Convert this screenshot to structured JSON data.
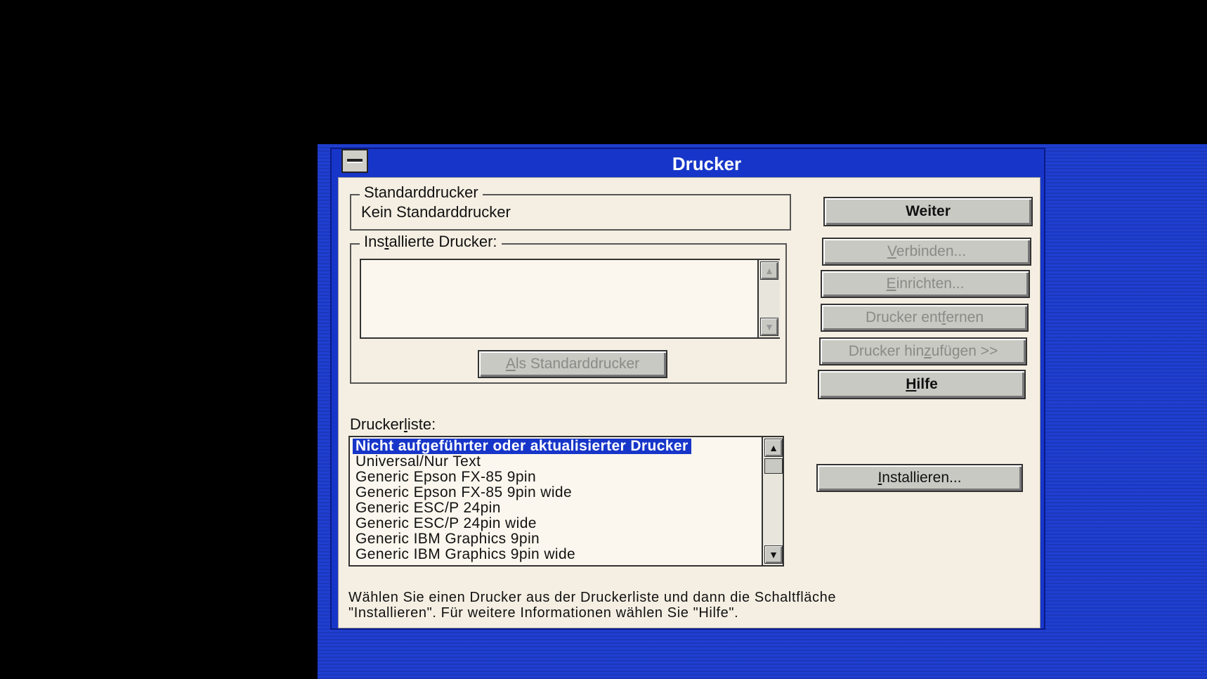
{
  "window": {
    "title": "Drucker"
  },
  "default_printer": {
    "label": "Standarddrucker",
    "value": "Kein Standarddrucker"
  },
  "installed": {
    "label_pre": "Ins",
    "label_ul": "t",
    "label_post": "allierte Drucker:",
    "set_default_ul": "A",
    "set_default_rest": "ls Standarddrucker"
  },
  "buttons": {
    "weiter": "Weiter",
    "verbinden_ul": "V",
    "verbinden_rest": "erbinden...",
    "einrichten_ul": "E",
    "einrichten_rest": "inrichten...",
    "entfernen_pre": "Drucker ent",
    "entfernen_ul": "f",
    "entfernen_post": "ernen",
    "hinzufuegen_pre": "Drucker hin",
    "hinzufuegen_ul": "z",
    "hinzufuegen_post": "ufügen >>",
    "hilfe_ul": "H",
    "hilfe_rest": "ilfe",
    "installieren_ul": "I",
    "installieren_rest": "nstallieren..."
  },
  "printer_list": {
    "label_pre": "Drucker",
    "label_ul": "l",
    "label_post": "iste:",
    "items": [
      "Nicht aufgeführter oder aktualisierter Drucker",
      "Universal/Nur Text",
      "Generic Epson FX-85 9pin",
      "Generic Epson FX-85 9pin wide",
      "Generic ESC/P 24pin",
      "Generic ESC/P 24pin wide",
      "Generic IBM Graphics 9pin",
      "Generic IBM Graphics 9pin wide"
    ],
    "selected_index": 0
  },
  "help_text": {
    "line1": "Wählen Sie einen Drucker aus der Druckerliste und dann die Schaltfläche",
    "line2": "\"Installieren\". Für weitere Informationen wählen Sie \"Hilfe\"."
  },
  "icons": {
    "system_menu": "system-menu-icon",
    "scroll_up": "▲",
    "scroll_down": "▼"
  }
}
